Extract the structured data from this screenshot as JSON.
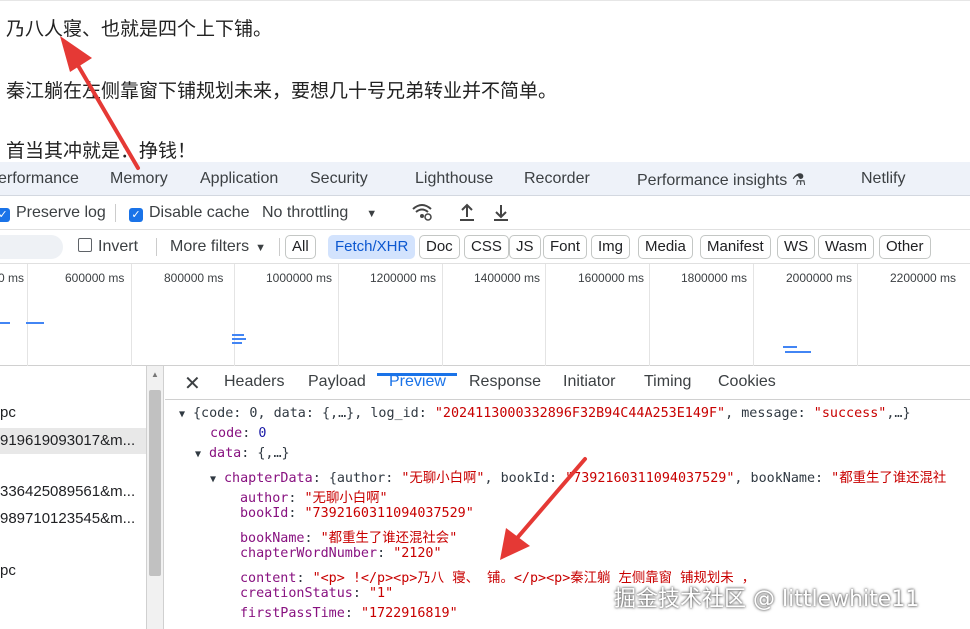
{
  "article": {
    "line1": "乃八人寝、也就是四个上下铺。",
    "line2": "秦江躺在左侧靠窗下铺规划未来，要想几十号兄弟转业并不简单。",
    "line3": "首当其冲就是：挣钱！"
  },
  "panel_tabs": [
    "erformance",
    "Memory",
    "Application",
    "Security",
    "Lighthouse",
    "Recorder",
    "Performance insights",
    "Netlify"
  ],
  "toolbar": {
    "preserve_log": "Preserve log",
    "disable_cache": "Disable cache",
    "throttling": "No throttling",
    "invert": "Invert",
    "more_filters": "More filters"
  },
  "filter_chips": [
    "All",
    "Fetch/XHR",
    "Doc",
    "CSS",
    "JS",
    "Font",
    "Img",
    "Media",
    "Manifest",
    "WS",
    "Wasm",
    "Other"
  ],
  "active_filter": "Fetch/XHR",
  "timeline_ticks": [
    "0 ms",
    "600000 ms",
    "800000 ms",
    "1000000 ms",
    "1200000 ms",
    "1400000 ms",
    "1600000 ms",
    "1800000 ms",
    "2000000 ms",
    "2200000 ms"
  ],
  "requests": [
    {
      "name": "pc"
    },
    {
      "name": "919619093017&m..."
    },
    {
      "name": ""
    },
    {
      "name": "336425089561&m..."
    },
    {
      "name": "989710123545&m..."
    },
    {
      "name": ""
    },
    {
      "name": "pc"
    }
  ],
  "detail_tabs": [
    "Headers",
    "Payload",
    "Preview",
    "Response",
    "Initiator",
    "Timing",
    "Cookies"
  ],
  "active_detail_tab": "Preview",
  "preview": {
    "root_summary_a": "{code: 0, data: {,…}, log_id: ",
    "root_log_id": "\"2024113000332896F32B94C44A253E149F\"",
    "root_summary_b": ", message: ",
    "root_message": "\"success\"",
    "root_summary_c": ",…}",
    "code_key": "code",
    "code_val": "0",
    "data_key": "data",
    "data_summary": "{,…}",
    "chapterData_key": "chapterData",
    "chapterData_summary_a": "{author: ",
    "chapterData_author": "\"无聊小白啊\"",
    "chapterData_summary_b": ", bookId: ",
    "chapterData_bookId": "\"7392160311094037529\"",
    "chapterData_summary_c": ", bookName: ",
    "chapterData_bookName": "\"都重生了谁还混社",
    "fields": [
      {
        "key": "author",
        "val": "\"无聊小白啊\""
      },
      {
        "key": "bookId",
        "val": "\"7392160311094037529\""
      },
      {
        "key": "bookName",
        "val": "\"都重生了谁还混社会\""
      },
      {
        "key": "chapterWordNumber",
        "val": "\"2120\""
      },
      {
        "key": "content",
        "val": "\"<p>      !</p><p>乃八  寝、          铺。</p><p>秦江躺  左侧靠窗  铺规划未  ，"
      },
      {
        "key": "creationStatus",
        "val": "\"1\""
      },
      {
        "key": "firstPassTime",
        "val": "\"1722916819\""
      }
    ]
  },
  "watermark": "掘金技术社区 @ littlewhite11",
  "colors": {
    "accent": "#1a73e8",
    "arrow": "#e53935",
    "string": "#c80000",
    "key": "#881280"
  }
}
